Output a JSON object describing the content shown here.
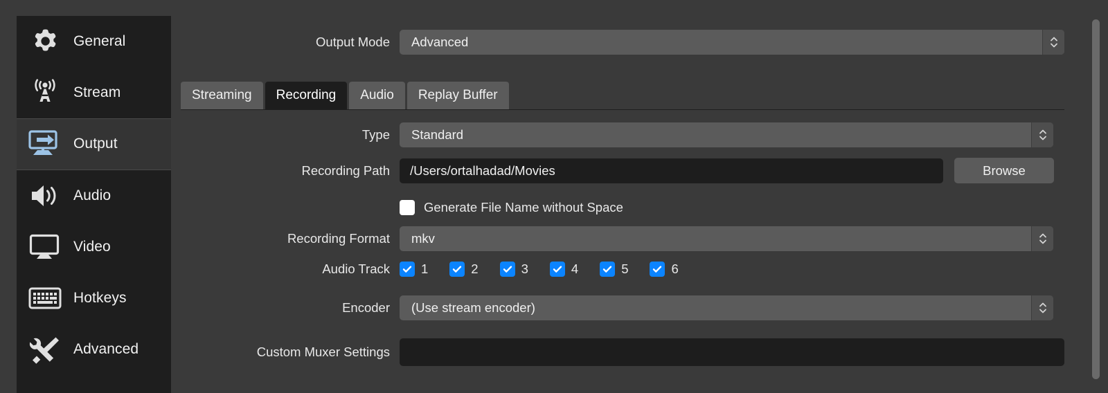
{
  "sidebar": {
    "items": [
      {
        "label": "General",
        "icon": "gear-icon",
        "selected": false
      },
      {
        "label": "Stream",
        "icon": "broadcast-icon",
        "selected": false
      },
      {
        "label": "Output",
        "icon": "output-monitor-icon",
        "selected": true
      },
      {
        "label": "Audio",
        "icon": "speaker-icon",
        "selected": false
      },
      {
        "label": "Video",
        "icon": "monitor-icon",
        "selected": false
      },
      {
        "label": "Hotkeys",
        "icon": "keyboard-icon",
        "selected": false
      },
      {
        "label": "Advanced",
        "icon": "wrench-screwdriver-icon",
        "selected": false
      }
    ]
  },
  "output_mode": {
    "label": "Output Mode",
    "value": "Advanced"
  },
  "tabs": [
    {
      "label": "Streaming",
      "active": false
    },
    {
      "label": "Recording",
      "active": true
    },
    {
      "label": "Audio",
      "active": false
    },
    {
      "label": "Replay Buffer",
      "active": false
    }
  ],
  "recording": {
    "type": {
      "label": "Type",
      "value": "Standard"
    },
    "path": {
      "label": "Recording Path",
      "value": "/Users/ortalhadad/Movies",
      "browse_label": "Browse"
    },
    "no_space": {
      "label": "Generate File Name without Space",
      "checked": false
    },
    "format": {
      "label": "Recording Format",
      "value": "mkv"
    },
    "audio_track": {
      "label": "Audio Track",
      "tracks": [
        {
          "number": "1",
          "checked": true
        },
        {
          "number": "2",
          "checked": true
        },
        {
          "number": "3",
          "checked": true
        },
        {
          "number": "4",
          "checked": true
        },
        {
          "number": "5",
          "checked": true
        },
        {
          "number": "6",
          "checked": true
        }
      ]
    },
    "encoder": {
      "label": "Encoder",
      "value": "(Use stream encoder)"
    },
    "muxer": {
      "label": "Custom Muxer Settings",
      "value": ""
    }
  },
  "colors": {
    "accent_checkbox": "#0b84ff",
    "panel_bg": "#3a3a3a",
    "sidebar_bg": "#1e1e1e",
    "sidebar_selected": "#343434",
    "field_bg": "#5b5b5b",
    "input_bg": "#1d1d1d",
    "output_icon": "#9cc3e6"
  }
}
